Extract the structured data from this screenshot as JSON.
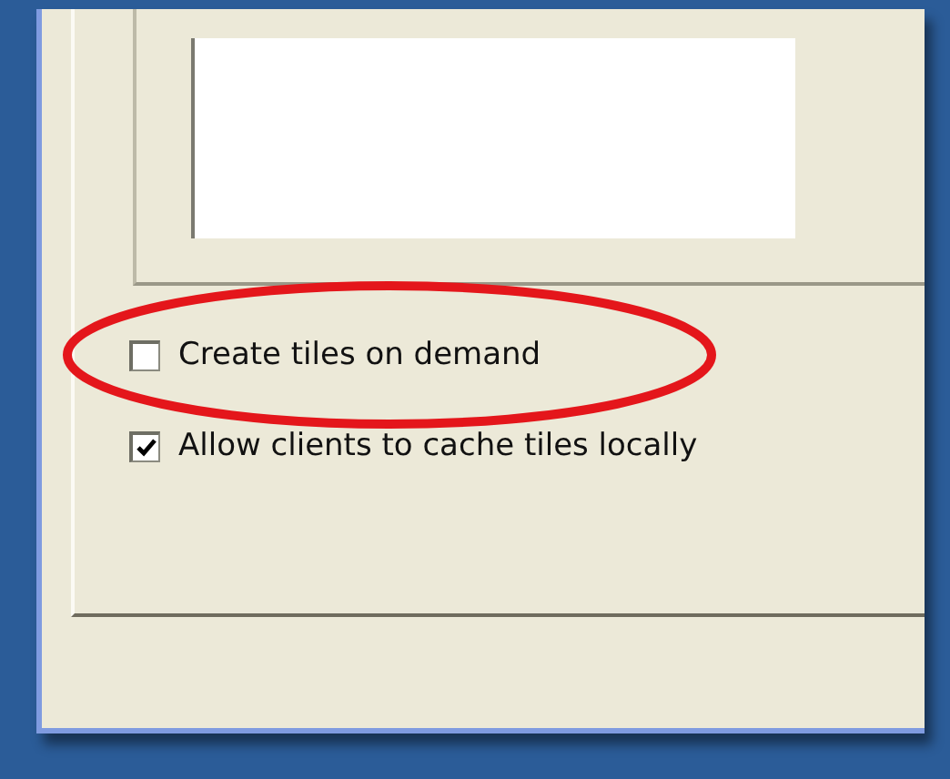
{
  "options": [
    {
      "label": "Create tiles on demand",
      "checked": false,
      "highlighted": true
    },
    {
      "label": "Allow clients to cache tiles locally",
      "checked": true,
      "highlighted": false
    }
  ]
}
